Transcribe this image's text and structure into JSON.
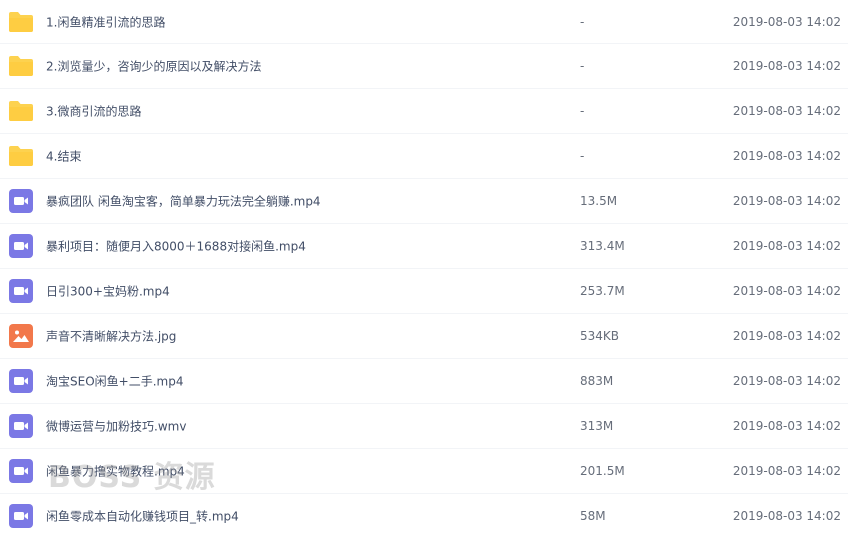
{
  "files": [
    {
      "icon": "folder-icon",
      "name": "1.闲鱼精准引流的思路",
      "size": "-",
      "modified": "2019-08-03 14:02"
    },
    {
      "icon": "folder-icon",
      "name": "2.浏览量少，咨询少的原因以及解决方法",
      "size": "-",
      "modified": "2019-08-03 14:02"
    },
    {
      "icon": "folder-icon",
      "name": "3.微商引流的思路",
      "size": "-",
      "modified": "2019-08-03 14:02"
    },
    {
      "icon": "folder-icon",
      "name": "4.结束",
      "size": "-",
      "modified": "2019-08-03 14:02"
    },
    {
      "icon": "video-file-icon",
      "name": "暴疯团队 闲鱼淘宝客，简单暴力玩法完全躺赚.mp4",
      "size": "13.5M",
      "modified": "2019-08-03 14:02"
    },
    {
      "icon": "video-file-icon",
      "name": "暴利项目：随便月入8000＋1688对接闲鱼.mp4",
      "size": "313.4M",
      "modified": "2019-08-03 14:02"
    },
    {
      "icon": "video-file-icon",
      "name": "日引300+宝妈粉.mp4",
      "size": "253.7M",
      "modified": "2019-08-03 14:02"
    },
    {
      "icon": "image-file-icon",
      "name": "声音不清晰解决方法.jpg",
      "size": "534KB",
      "modified": "2019-08-03 14:02"
    },
    {
      "icon": "video-file-icon",
      "name": "淘宝SEO闲鱼+二手.mp4",
      "size": "883M",
      "modified": "2019-08-03 14:02"
    },
    {
      "icon": "video-file-icon",
      "name": "微博运营与加粉技巧.wmv",
      "size": "313M",
      "modified": "2019-08-03 14:02"
    },
    {
      "icon": "video-file-icon",
      "name": "闲鱼暴力撸实物教程.mp4",
      "size": "201.5M",
      "modified": "2019-08-03 14:02"
    },
    {
      "icon": "video-file-icon",
      "name": "闲鱼零成本自动化赚钱项目_转.mp4",
      "size": "58M",
      "modified": "2019-08-03 14:02"
    }
  ],
  "watermark": "BOSS 资源",
  "colors": {
    "folder": "#fdd24f",
    "video": "#7b78e5",
    "image": "#f2784b",
    "divider": "#f2f4f7"
  }
}
